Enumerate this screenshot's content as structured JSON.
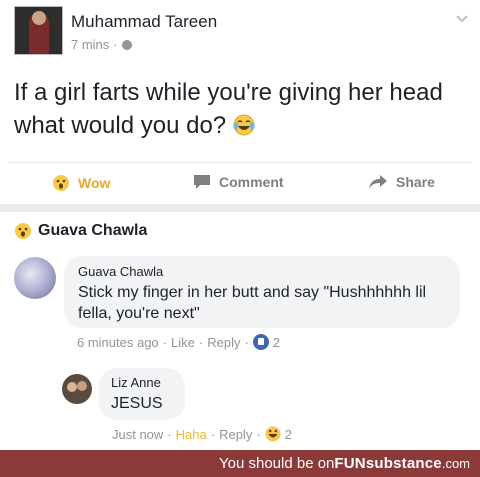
{
  "post": {
    "author": "Muhammad Tareen",
    "time": "7 mins",
    "separator": "·",
    "text": "If a girl farts while you're giving her head what would you do?"
  },
  "actions": {
    "wow": "Wow",
    "comment": "Comment",
    "share": "Share"
  },
  "reaction_line": {
    "name": "Guava Chawla"
  },
  "comments": [
    {
      "name": "Guava Chawla",
      "text": "Stick my finger in her butt and say \"Hushhhhhh lil fella, you're next\"",
      "time": "6 minutes ago",
      "like": "Like",
      "reply": "Reply",
      "reaction_count": "2"
    },
    {
      "name": "Liz Anne",
      "text": "JESUS",
      "time": "Just now",
      "haha": "Haha",
      "reply": "Reply",
      "reaction_count": "2"
    }
  ],
  "footer": {
    "prefix": "You should be on ",
    "brand_main": "FUNsubstance",
    "brand_suffix": ".com"
  },
  "colors": {
    "wow": "#e4a92e",
    "like_blue": "#4267b2",
    "haha": "#f7b928",
    "footer_bg": "#8c3939"
  },
  "icons": [
    "globe-icon",
    "chevron-down-icon",
    "laughing-tears-emoji-icon",
    "wow-icon",
    "comment-icon",
    "share-icon",
    "like-icon",
    "haha-icon"
  ]
}
